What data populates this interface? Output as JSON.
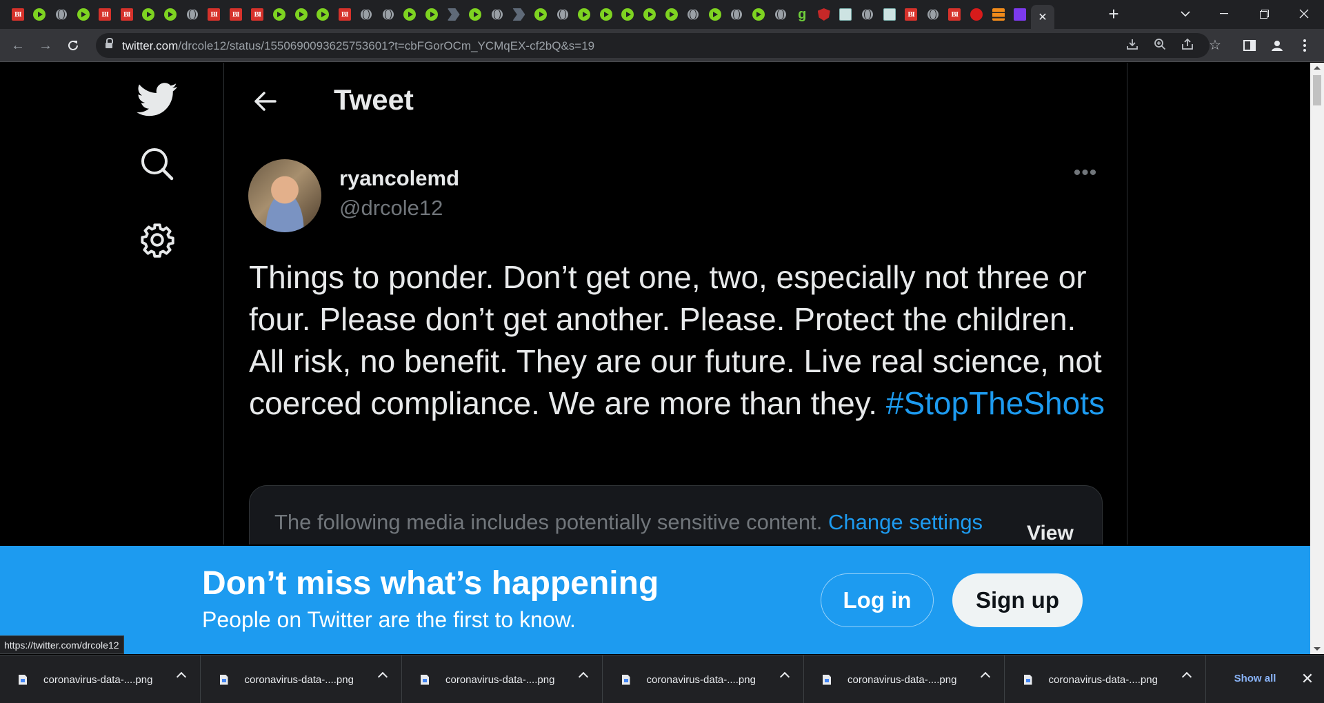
{
  "browser": {
    "tab_favicons": [
      "bi",
      "play",
      "globe",
      "play",
      "bi",
      "bi",
      "play",
      "play",
      "globe",
      "bi",
      "bi",
      "bi",
      "play",
      "play",
      "play",
      "bi",
      "globe",
      "globe",
      "play",
      "play",
      "arrow",
      "play",
      "globe",
      "arrow",
      "play",
      "globe",
      "play",
      "play",
      "play",
      "play",
      "play",
      "globe",
      "play",
      "globe",
      "play",
      "globe",
      "g",
      "shield",
      "map",
      "globe",
      "map",
      "bi",
      "globe",
      "bi",
      "pin",
      "stack",
      "mail"
    ],
    "active_tab_close": "✕",
    "new_tab": "+",
    "url_host": "twitter.com",
    "url_path": "/drcole12/status/1550690093625753601?t=cbFGorOCm_YCMqEX-cf2bQ&s=19"
  },
  "twitter": {
    "header_title": "Tweet",
    "display_name": "ryancolemd",
    "handle": "@drcole12",
    "more": "•••",
    "tweet_text": "Things to ponder. Don’t get one, two, especially not three or four. Please don’t get another. Please. Protect the children. All risk, no benefit. They are our future. Live real science, not coerced compliance. We are more than they.",
    "hashtag": "#StopTheShots",
    "media_notice": "The following media includes potentially sensitive content.",
    "media_change_link": "Change settings",
    "media_view": "View"
  },
  "banner": {
    "title": "Don’t miss what’s happening",
    "subtitle": "People on Twitter are the first to know.",
    "login": "Log in",
    "signup": "Sign up"
  },
  "status_bar_url": "https://twitter.com/drcole12",
  "downloads": {
    "items": [
      {
        "name": "coronavirus-data-....png"
      },
      {
        "name": "coronavirus-data-....png"
      },
      {
        "name": "coronavirus-data-....png"
      },
      {
        "name": "coronavirus-data-....png"
      },
      {
        "name": "coronavirus-data-....png"
      },
      {
        "name": "coronavirus-data-....png"
      }
    ],
    "show_all": "Show all",
    "close": "✕"
  },
  "colors": {
    "twitter_blue": "#1d9bf0",
    "page_bg": "#000000",
    "chrome_dark": "#202124"
  }
}
